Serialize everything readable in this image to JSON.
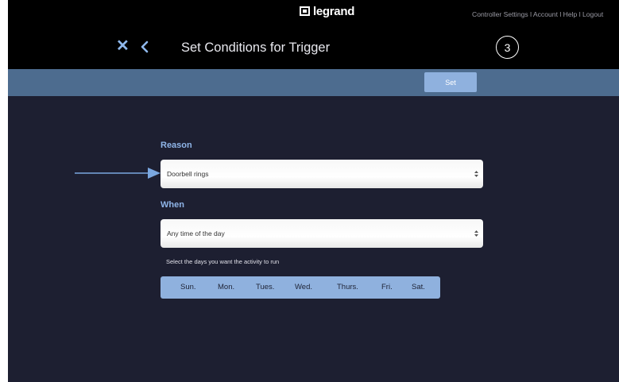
{
  "brand": {
    "logo_text": "legrand",
    "logo_mark": "legrand-logo-icon"
  },
  "top_nav": {
    "items": [
      "Controller Settings",
      "Account",
      "Help",
      "Logout"
    ],
    "display_text": "Controller Settings l Account l Help l Logout"
  },
  "header": {
    "close_icon": "close-icon",
    "back_icon": "chevron-left-icon",
    "title": "Set Conditions for Trigger",
    "step": "3"
  },
  "action_bar": {
    "set_label": "Set"
  },
  "form": {
    "reason": {
      "label": "Reason",
      "value": "Doorbell rings"
    },
    "when": {
      "label": "When",
      "value": "Any time of the day"
    },
    "days_hint": "Select the days you want the activity to run",
    "days": [
      "Sun.",
      "Mon.",
      "Tues.",
      "Wed.",
      "Thurs.",
      "Fri.",
      "Sat."
    ]
  },
  "colors": {
    "background": "#1d1f31",
    "topbar": "#000000",
    "action_bar": "#4d6c8f",
    "accent": "#8fb1de",
    "label": "#8fb5e8",
    "annotation_arrow": "#7aa7e0"
  }
}
